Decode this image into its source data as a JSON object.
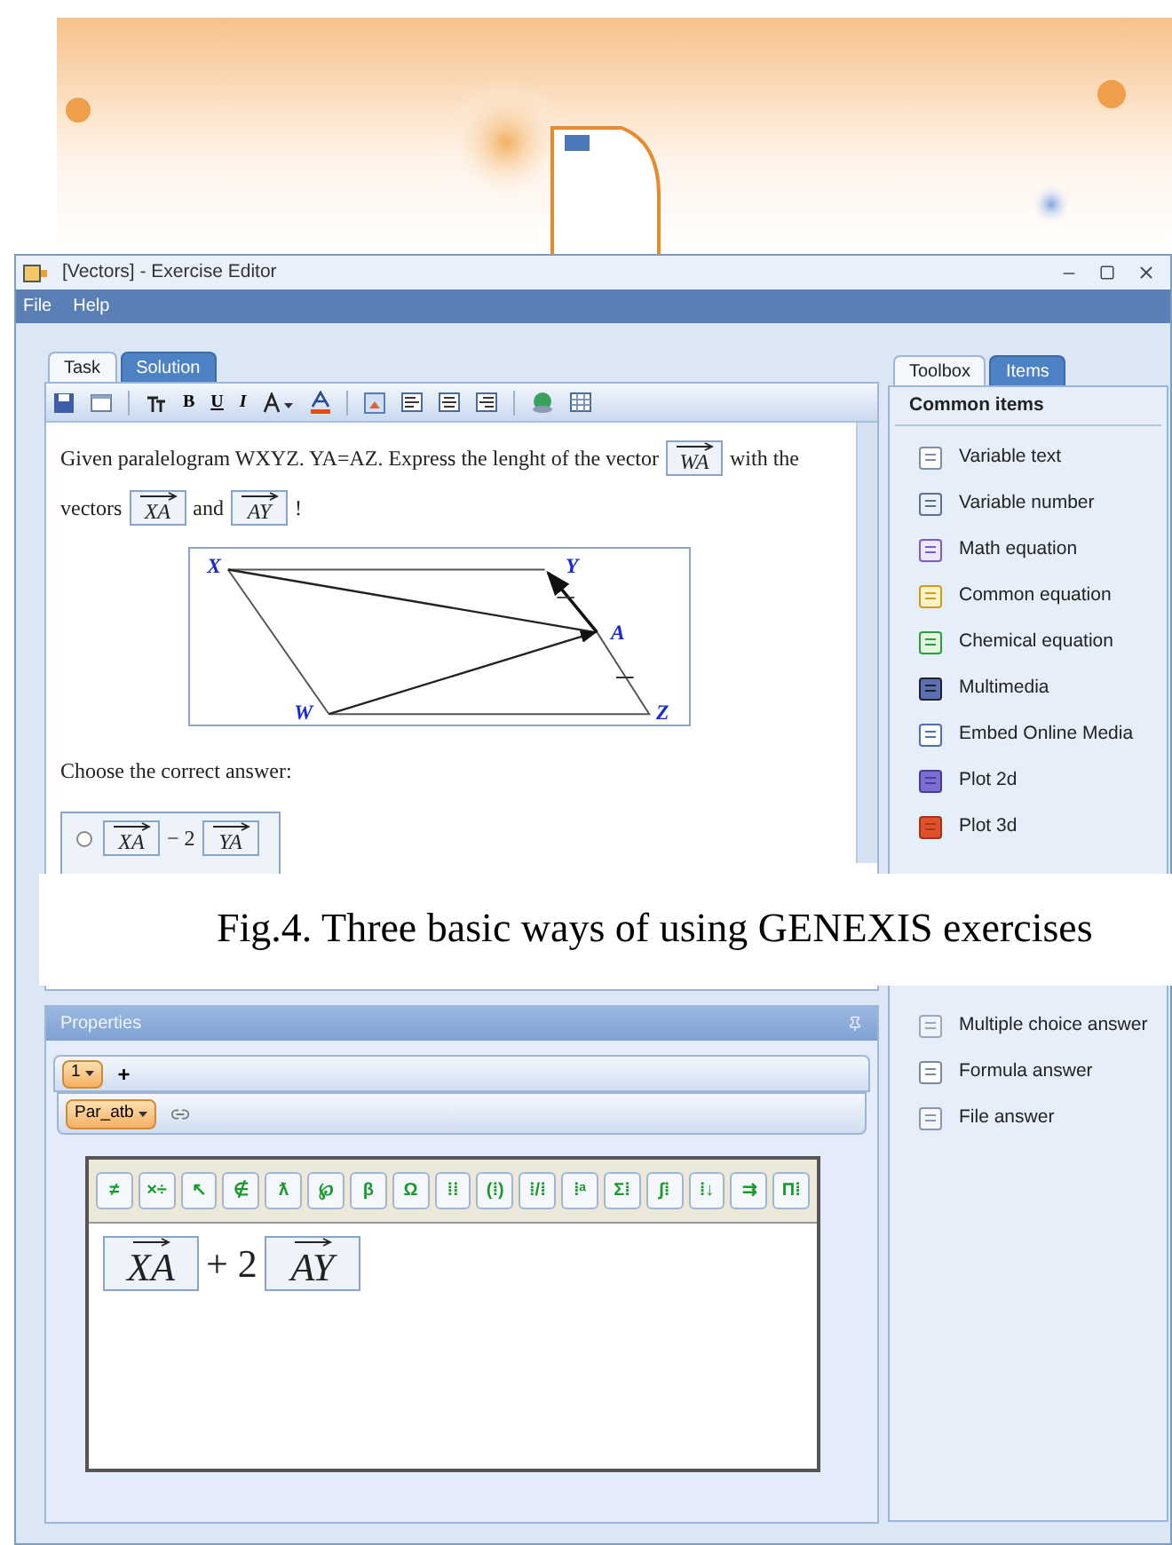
{
  "window": {
    "title": "[Vectors] - Exercise Editor"
  },
  "menu": [
    "File",
    "Help"
  ],
  "editor_tabs": [
    {
      "label": "Task",
      "selected": true
    },
    {
      "label": "Solution",
      "selected": false
    }
  ],
  "format_buttons": [
    "B",
    "U",
    "I"
  ],
  "question": [
    {
      "kind": "text",
      "text": "Given paralelogram WXYZ. YA=AZ. Express the lenght of the vector"
    },
    {
      "kind": "vector",
      "text": "WA"
    },
    {
      "kind": "text",
      "text": "with the"
    },
    {
      "kind": "break"
    },
    {
      "kind": "text",
      "text": "vectors"
    },
    {
      "kind": "vector",
      "text": "XA"
    },
    {
      "kind": "text",
      "text": "and"
    },
    {
      "kind": "vector",
      "text": "AY"
    },
    {
      "kind": "text",
      "text": "!"
    }
  ],
  "diagram": {
    "points": [
      "X",
      "Y",
      "A",
      "W",
      "Z"
    ]
  },
  "prompt": "Choose the correct answer:",
  "answers": [
    {
      "selected": false,
      "terms": [
        {
          "kind": "vector",
          "text": "XA"
        },
        {
          "kind": "text",
          "text": "− 2"
        },
        {
          "kind": "vector",
          "text": "YA"
        }
      ]
    }
  ],
  "properties": {
    "title": "Properties",
    "number": "1",
    "add": "+",
    "parameter": "Par_atb"
  },
  "equation_toolbar": [
    "≠",
    "×÷",
    "↖",
    "∉",
    "ƛ",
    "℘",
    "β",
    "Ω",
    "⁞⁞",
    "(⁞)",
    "⁞/⁞",
    "⁞ᵃ",
    "Σ⁞",
    "∫⁞",
    "⁞↓",
    "⇉",
    "Π⁞"
  ],
  "formula": [
    {
      "kind": "vector",
      "text": "XA"
    },
    {
      "kind": "text",
      "text": "+ 2"
    },
    {
      "kind": "vector",
      "text": "AY"
    }
  ],
  "toolbox_tabs": [
    {
      "label": "Toolbox",
      "selected": true
    },
    {
      "label": "Items",
      "selected": false
    }
  ],
  "toolbox": {
    "header": "Common items",
    "items": [
      "Variable text",
      "Variable number",
      "Math equation",
      "Common equation",
      "Chemical equation",
      "Multimedia",
      "Embed Online Media",
      "Plot 2d",
      "Plot 3d"
    ]
  },
  "answer_items": [
    "Multiple choice answer",
    "Formula answer",
    "File answer"
  ],
  "caption": "Fig.4. Three basic ways of using GENEXIS exercises"
}
